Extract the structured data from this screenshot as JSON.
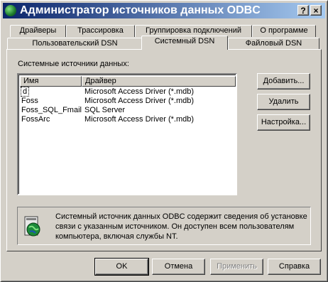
{
  "window": {
    "title": "Администратор источников данных ODBC",
    "help_label": "?",
    "close_label": "×"
  },
  "tabs_row1": [
    "Драйверы",
    "Трассировка",
    "Группировка подключений",
    "О программе"
  ],
  "tabs_row2": [
    "Пользовательский DSN",
    "Системный DSN",
    "Файловый DSN"
  ],
  "active_tab": "Системный DSN",
  "panel": {
    "list_label": "Системные источники данных:",
    "columns": [
      "Имя",
      "Драйвер"
    ],
    "rows": [
      {
        "name": "d",
        "driver": "Microsoft Access Driver (*.mdb)"
      },
      {
        "name": "Foss",
        "driver": "Microsoft Access Driver (*.mdb)"
      },
      {
        "name": "Foss_SQL_Fmail",
        "driver": "SQL Server"
      },
      {
        "name": "FossArc",
        "driver": "Microsoft Access Driver (*.mdb)"
      }
    ],
    "selected_row": "d",
    "add_label": "Добавить...",
    "remove_label": "Удалить",
    "configure_label": "Настройка...",
    "info_text": "Системный источник данных ODBC содержит сведения об установке связи с указанным источником. Он доступен всем пользователям компьютера, включая службы NT."
  },
  "buttons": {
    "ok": "OK",
    "cancel": "Отмена",
    "apply": "Применить",
    "help": "Справка"
  },
  "colors": {
    "title_start": "#0a246a",
    "title_end": "#a6caf0",
    "face": "#d4d0c8"
  }
}
